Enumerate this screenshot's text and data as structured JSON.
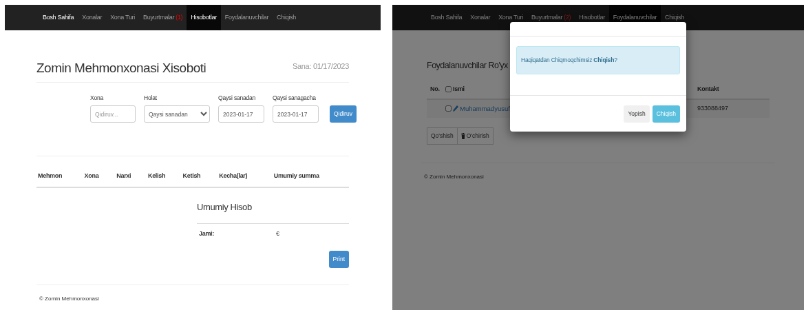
{
  "report_page": {
    "nav": [
      {
        "label": "Bosh Sahifa",
        "selected": false,
        "brand": true
      },
      {
        "label": "Xonalar",
        "selected": false
      },
      {
        "label": "Xona Turi",
        "selected": false
      },
      {
        "label": "Buyurtmalar",
        "badge": "(1)",
        "selected": false
      },
      {
        "label": "Hisobotlar",
        "selected": true
      },
      {
        "label": "Foydalanuvchilar",
        "selected": false
      },
      {
        "label": "Chiqish",
        "selected": false
      }
    ],
    "title": "Zomin Mehmonxonasi Xisoboti",
    "date": "Sana: 01/17/2023",
    "filters": [
      {
        "kind": "text",
        "label": "Xona",
        "placeholder": "Qidiruv..."
      },
      {
        "kind": "select",
        "label": "Holat",
        "value": "Qaysi sanadan"
      },
      {
        "kind": "date",
        "label": "Qaysi sanadan",
        "value": "2023-01-17"
      },
      {
        "kind": "date",
        "label": "Qaysi sanagacha",
        "value": "2023-01-17"
      }
    ],
    "search_button": "Qidiruv",
    "columns": [
      "Mehmon",
      "Xona",
      "Narxi",
      "Kelish",
      "Ketish",
      "Kecha(lar)",
      "Umumiy summa"
    ],
    "summary": {
      "title": "Umumiy Hisob",
      "total_label": "Jami:",
      "total_value": "€"
    },
    "print_button": "Print",
    "footer": "© Zomin Mehmonxonasi"
  },
  "users_page": {
    "nav": [
      {
        "label": "Bosh Sahifa",
        "selected": false
      },
      {
        "label": "Xonalar",
        "selected": false
      },
      {
        "label": "Xona Turi",
        "selected": false
      },
      {
        "label": "Buyurtmalar",
        "badge": "(2)",
        "selected": false
      },
      {
        "label": "Hisobotlar",
        "selected": false
      },
      {
        "label": "Foydalanuvchilar",
        "selected": true
      },
      {
        "label": "Chiqish",
        "selected": false
      }
    ],
    "title": "Foydalanuvchilar Ro'yx",
    "columns": [
      {
        "label": "No."
      },
      {
        "label": "Ismi",
        "checkbox": true,
        "checked": false
      },
      {
        "label": "Kontakt"
      }
    ],
    "rows": [
      {
        "name": "Muhammadyusuf",
        "contact": "933088497",
        "checked": false
      }
    ],
    "actions": [
      "Qo'shish",
      "O'chirish"
    ],
    "footer": "© Zomin Mehmonxonasi",
    "modal": {
      "message": "Haqiqatdan Chiqmoqchimsiz **Chiqish**?",
      "buttons": [
        {
          "label": "Yopish",
          "kind": "secondary"
        },
        {
          "label": "Chiqish",
          "kind": "info"
        }
      ]
    }
  }
}
